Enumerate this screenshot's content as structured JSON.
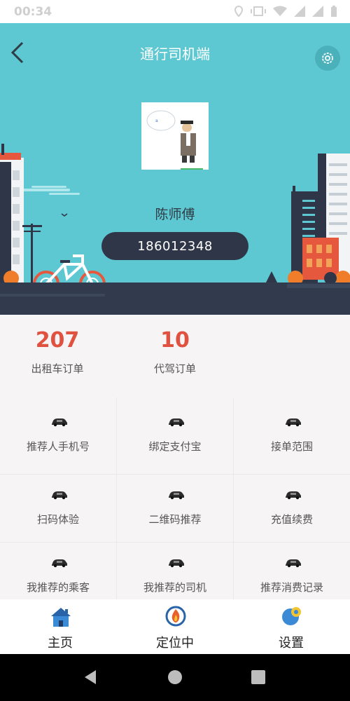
{
  "status_bar": {
    "time": "00:34"
  },
  "header": {
    "title": "通行司机端"
  },
  "profile": {
    "name": "陈师傅",
    "phone": "186012348"
  },
  "stats": [
    {
      "value": "207",
      "label": "出租车订单"
    },
    {
      "value": "10",
      "label": "代驾订单"
    }
  ],
  "menu": [
    {
      "label": "推荐人手机号",
      "icon": "car-icon"
    },
    {
      "label": "绑定支付宝",
      "icon": "car-icon"
    },
    {
      "label": "接单范围",
      "icon": "car-icon"
    },
    {
      "label": "扫码体验",
      "icon": "car-icon"
    },
    {
      "label": "二维码推荐",
      "icon": "car-icon"
    },
    {
      "label": "充值续费",
      "icon": "car-icon"
    },
    {
      "label": "我推荐的乘客",
      "icon": "car-icon"
    },
    {
      "label": "我推荐的司机",
      "icon": "car-icon"
    },
    {
      "label": "推荐消费记录",
      "icon": "car-icon"
    }
  ],
  "tabs": [
    {
      "label": "主页",
      "icon": "house-icon"
    },
    {
      "label": "定位中",
      "icon": "location-flame-icon"
    },
    {
      "label": "设置",
      "icon": "settings-icon"
    }
  ],
  "colors": {
    "hero": "#5ec8d2",
    "accent": "#e0523f",
    "pill": "#2f3648"
  }
}
